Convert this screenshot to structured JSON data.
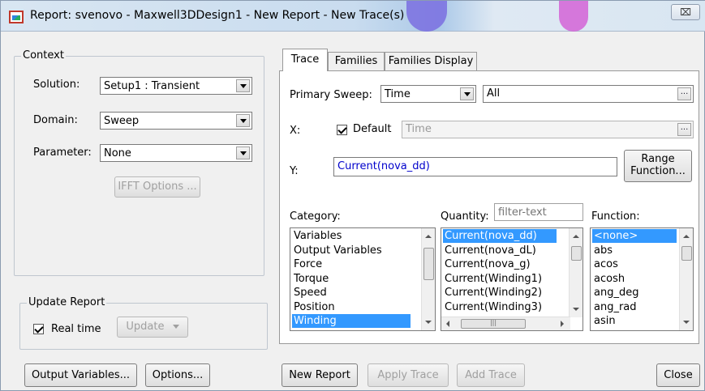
{
  "window": {
    "title": "Report: svenovo - Maxwell3DDesign1 - New Report - New Trace(s)",
    "close_glyph": "⌧"
  },
  "context": {
    "group_label": "Context",
    "solution_label": "Solution:",
    "solution_value": "Setup1 : Transient",
    "domain_label": "Domain:",
    "domain_value": "Sweep",
    "parameter_label": "Parameter:",
    "parameter_value": "None",
    "ifft_button": "IFFT Options ..."
  },
  "update_report": {
    "group_label": "Update Report",
    "realtime_label": "Real time",
    "realtime_checked": true,
    "update_button": "Update"
  },
  "tabs": [
    {
      "label": "Trace",
      "active": true
    },
    {
      "label": "Families",
      "active": false
    },
    {
      "label": "Families Display",
      "active": false
    }
  ],
  "trace": {
    "primary_sweep_label": "Primary Sweep:",
    "primary_sweep_value": "Time",
    "primary_sweep_range": "All",
    "ellipsis": "...",
    "x_label": "X:",
    "default_label": "Default",
    "default_checked": true,
    "x_value": "Time",
    "y_label": "Y:",
    "y_value": "Current(nova_dd)",
    "range_function_button_line1": "Range",
    "range_function_button_line2": "Function...",
    "category_label": "Category:",
    "quantity_label": "Quantity:",
    "quantity_filter_placeholder": "filter-text",
    "function_label": "Function:",
    "categories": [
      "Variables",
      "Output Variables",
      "Force",
      "Torque",
      "Speed",
      "Position",
      "Winding"
    ],
    "category_selected": "Winding",
    "quantities": [
      "Current(nova_dd)",
      "Current(nova_dL)",
      "Current(nova_g)",
      "Current(Winding1)",
      "Current(Winding2)",
      "Current(Winding3)"
    ],
    "quantity_selected": "Current(nova_dd)",
    "functions": [
      "<none>",
      "abs",
      "acos",
      "acosh",
      "ang_deg",
      "ang_rad",
      "asin"
    ],
    "function_selected": "<none>"
  },
  "footer": {
    "output_variables_button": "Output Variables...",
    "options_button": "Options...",
    "new_report_button": "New Report",
    "apply_trace_button": "Apply Trace",
    "add_trace_button": "Add Trace",
    "close_button": "Close"
  },
  "colors": {
    "selection": "#3399ff",
    "window_bg": "#f0f0f0",
    "input_text_blue": "#0000cc"
  }
}
